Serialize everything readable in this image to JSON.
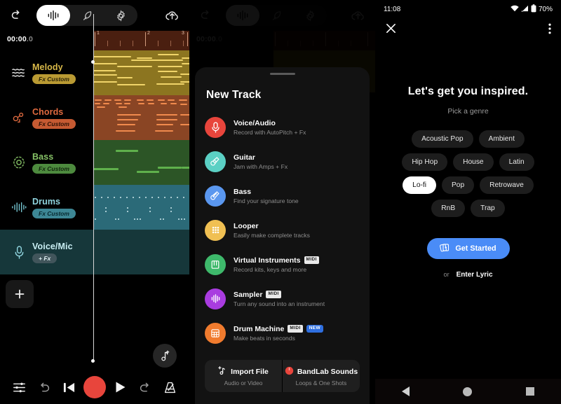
{
  "editor": {
    "toolbar": {
      "back_icon": "back-arrow-icon",
      "segments": [
        {
          "name": "waveform-icon",
          "active": true
        },
        {
          "name": "feather-icon",
          "active": false
        },
        {
          "name": "gear-icon",
          "active": false
        }
      ],
      "cloud_icon": "cloud-upload-icon"
    },
    "timecode": "00:00",
    "timecode_decimal": ".0",
    "ruler_marks": [
      "1",
      "2",
      "3"
    ],
    "tracks": [
      {
        "name": "Melody",
        "fx": "Fx Custom",
        "icon": "waves-icon",
        "color": "#d9b949",
        "chip_bg": "#b99a33",
        "clip_bg": "#8c7520",
        "note": "#f0d469"
      },
      {
        "name": "Chords",
        "fx": "Fx Custom",
        "icon": "chords-icon",
        "color": "#e06a3f",
        "chip_bg": "#c65a32",
        "clip_bg": "#8a4524",
        "note": "#f08a4d"
      },
      {
        "name": "Bass",
        "fx": "Fx Custom",
        "icon": "bass-target-icon",
        "color": "#86c166",
        "chip_bg": "#4d8a3e",
        "clip_bg": "#2c5526",
        "note": "#7fc96a"
      },
      {
        "name": "Drums",
        "fx": "Fx Custom",
        "icon": "drums-icon",
        "color": "#74c3cf",
        "chip_bg": "#3d8795",
        "clip_bg": "#2b6a78",
        "note": "#a9dce6"
      },
      {
        "name": "Voice/Mic",
        "fx": "+ Fx",
        "icon": "microphone-icon",
        "color": "#8fd4de",
        "chip_bg": "#41555b",
        "clip_bg": "#16373a",
        "note": "#16373a",
        "selected": true
      }
    ],
    "add_track_label": "+",
    "fab_icon": "add-note-icon",
    "bottom": {
      "mixer_icon": "mixer-sliders-icon",
      "undo_icon": "undo-icon",
      "skip_start_icon": "skip-to-start-icon",
      "record_icon": "record-button",
      "play_icon": "play-icon",
      "redo_icon": "redo-icon",
      "metronome_icon": "metronome-icon"
    }
  },
  "new_track_sheet": {
    "title": "New Track",
    "items": [
      {
        "title": "Voice/Audio",
        "subtitle": "Record with AutoPitch + Fx",
        "icon": "microphone-icon",
        "bg": "#e8453c",
        "badges": []
      },
      {
        "title": "Guitar",
        "subtitle": "Jam with Amps + Fx",
        "icon": "guitar-icon",
        "bg": "#5bd0c4",
        "badges": []
      },
      {
        "title": "Bass",
        "subtitle": "Find your signature tone",
        "icon": "bass-guitar-icon",
        "bg": "#5a97ef",
        "badges": []
      },
      {
        "title": "Looper",
        "subtitle": "Easily make complete tracks",
        "icon": "looper-pads-icon",
        "bg": "#f0c053",
        "badges": []
      },
      {
        "title": "Virtual Instruments",
        "subtitle": "Record kits, keys and more",
        "icon": "piano-keys-icon",
        "bg": "#3eb96b",
        "badges": [
          "MIDI"
        ]
      },
      {
        "title": "Sampler",
        "subtitle": "Turn any sound into an instrument",
        "icon": "sampler-wave-icon",
        "bg": "#a93ce0",
        "badges": [
          "MIDI"
        ]
      },
      {
        "title": "Drum Machine",
        "subtitle": "Make beats in seconds",
        "icon": "drum-machine-grid-icon",
        "bg": "#f07b2e",
        "badges": [
          "MIDI",
          "NEW"
        ]
      }
    ],
    "actions": [
      {
        "title": "Import File",
        "subtitle": "Audio or Video",
        "icon": "add-music-file-icon"
      },
      {
        "title": "BandLab Sounds",
        "subtitle": "Loops & One Shots",
        "icon": "bandlab-logo-icon"
      }
    ]
  },
  "genre_picker": {
    "status": {
      "time": "11:08",
      "battery": "70%",
      "wifi_icon": "wifi-icon",
      "signal_icon": "cell-signal-icon",
      "battery_icon": "battery-icon"
    },
    "close_icon": "close-icon",
    "overflow_icon": "more-vertical-icon",
    "headline": "Let's get you inspired.",
    "subtitle": "Pick a genre",
    "genres": [
      {
        "label": "Acoustic Pop",
        "selected": false
      },
      {
        "label": "Ambient",
        "selected": false
      },
      {
        "label": "Hip Hop",
        "selected": false
      },
      {
        "label": "House",
        "selected": false
      },
      {
        "label": "Latin",
        "selected": false
      },
      {
        "label": "Lo-fi",
        "selected": true
      },
      {
        "label": "Pop",
        "selected": false
      },
      {
        "label": "Retrowave",
        "selected": false
      },
      {
        "label": "RnB",
        "selected": false
      },
      {
        "label": "Trap",
        "selected": false
      }
    ],
    "cta_label": "Get Started",
    "cta_icon": "cards-icon",
    "cta_color": "#4a8cf7",
    "or_label": "or",
    "lyric_label": "Enter Lyric",
    "navbar": {
      "back_icon": "android-back-icon",
      "home_icon": "android-home-icon",
      "recents_icon": "android-recents-icon"
    }
  }
}
